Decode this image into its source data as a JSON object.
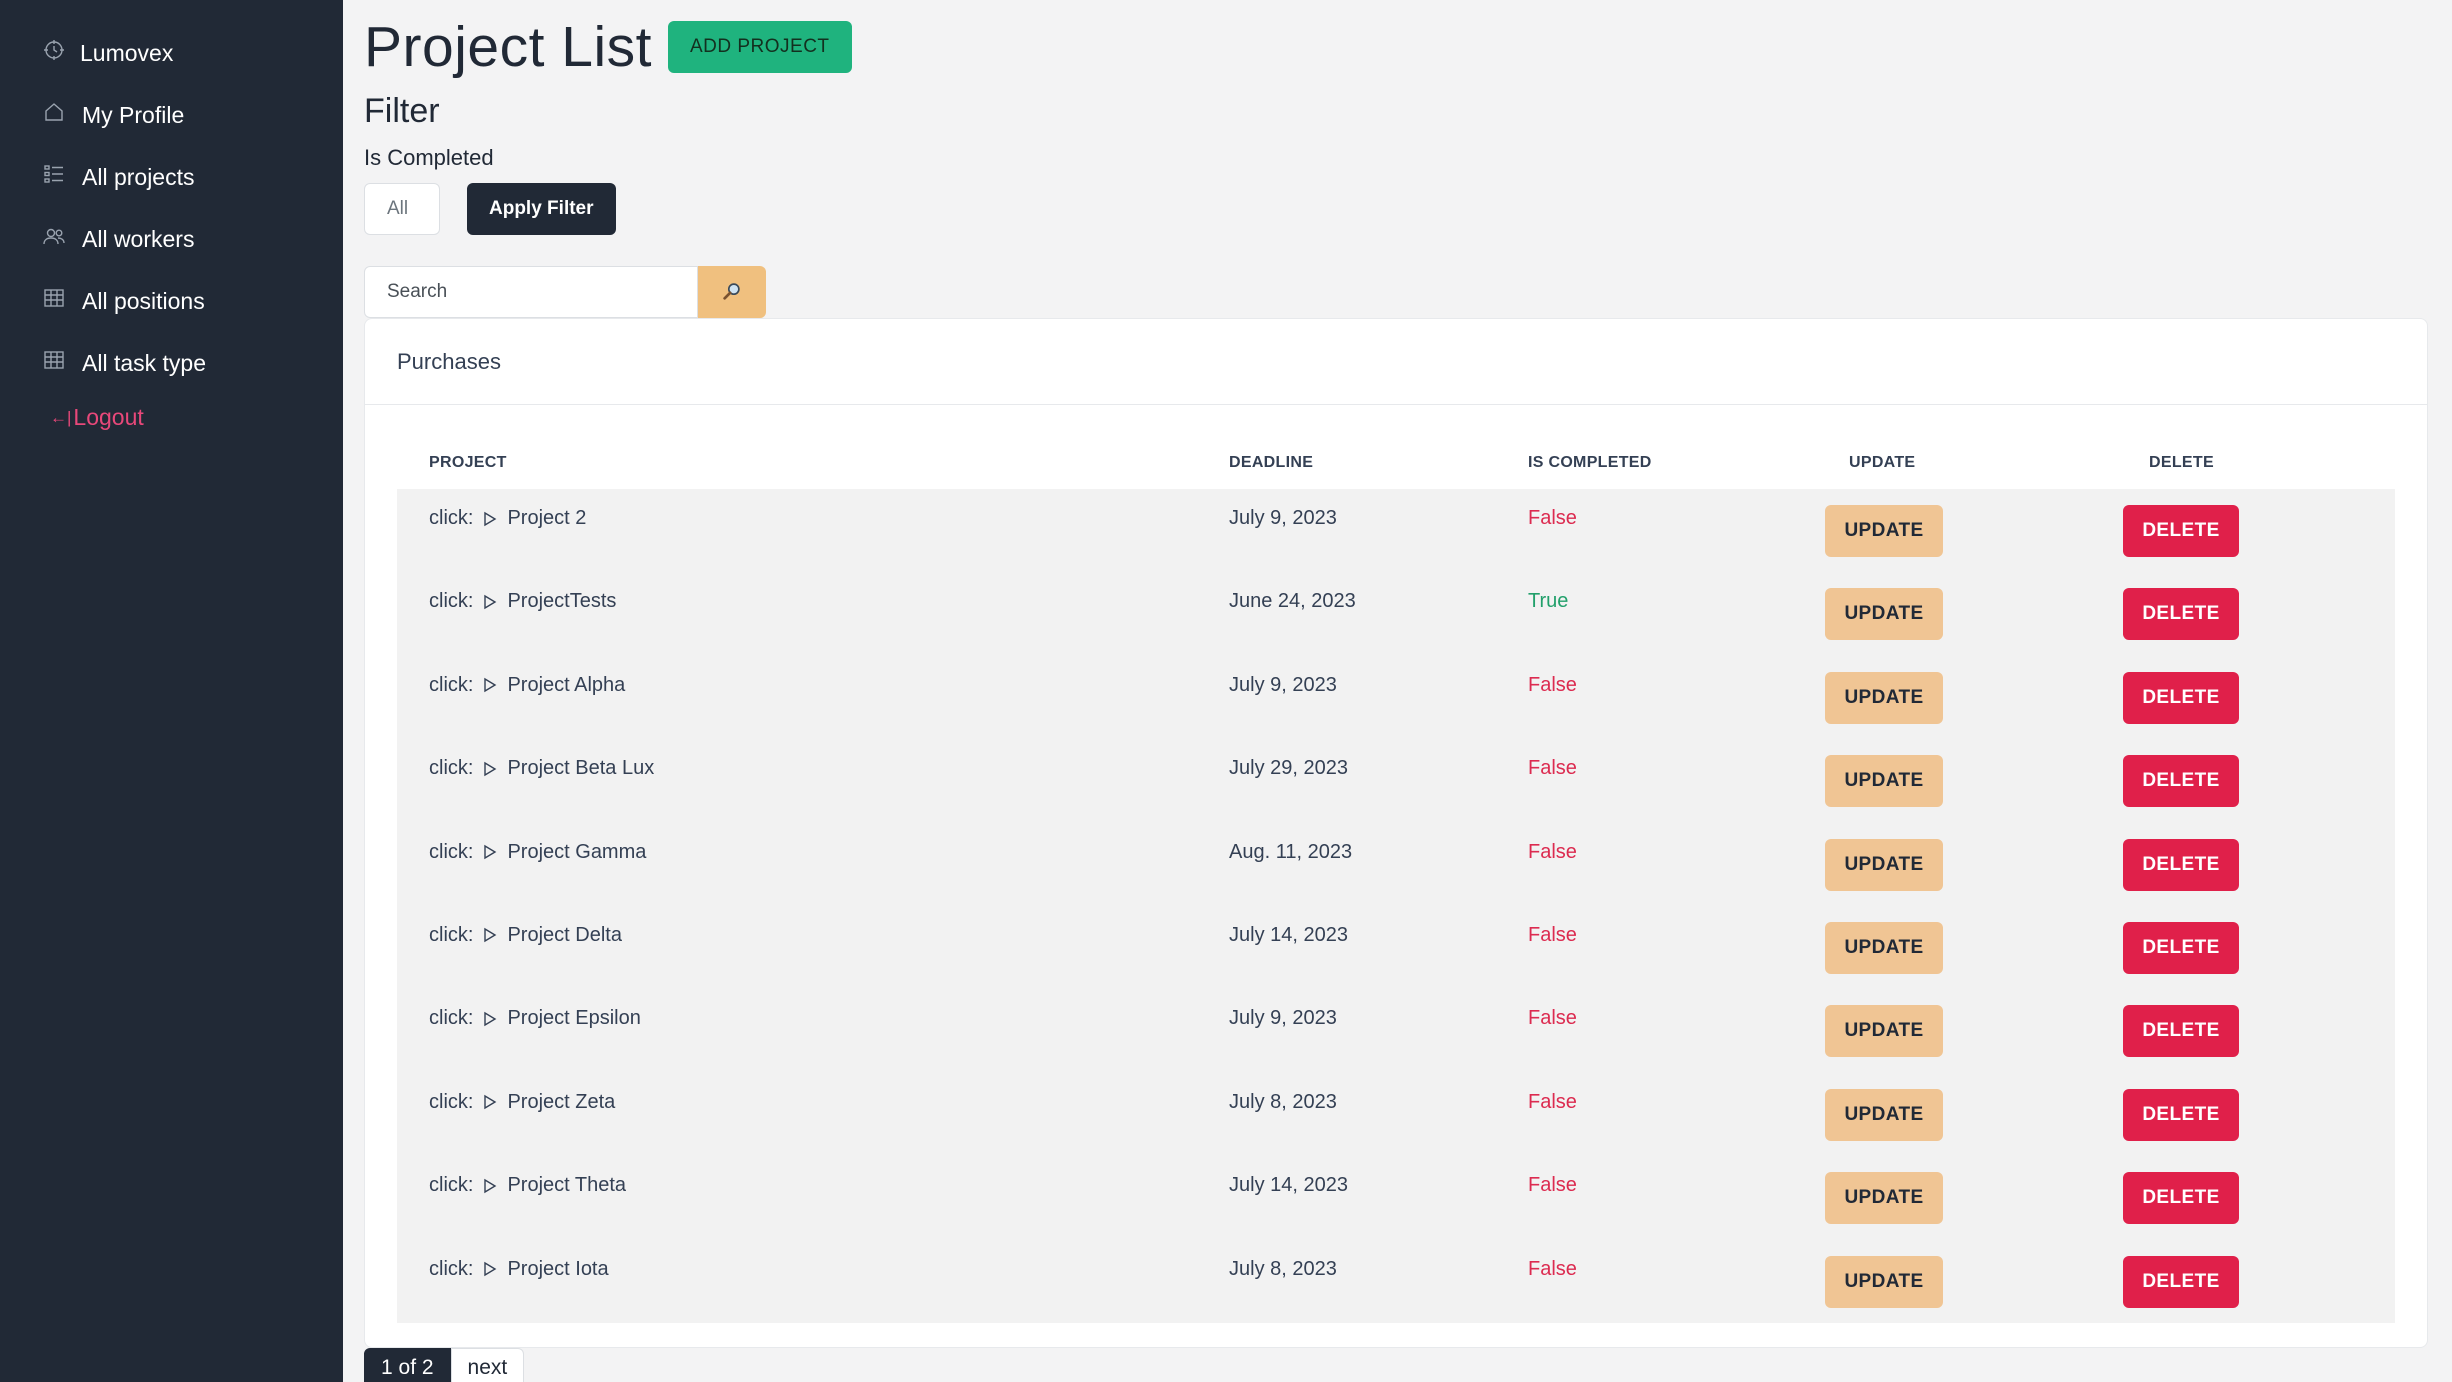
{
  "sidebar": {
    "brand": "Lumovex",
    "items": [
      {
        "label": "My Profile",
        "icon": "home-icon"
      },
      {
        "label": "All projects",
        "icon": "list-icon"
      },
      {
        "label": "All workers",
        "icon": "users-icon"
      },
      {
        "label": "All positions",
        "icon": "table-icon"
      },
      {
        "label": "All task type",
        "icon": "table-icon"
      }
    ],
    "logout_arrow": "←|",
    "logout": "Logout"
  },
  "header": {
    "title": "Project List",
    "add_button": "ADD PROJECT"
  },
  "filter": {
    "title": "Filter",
    "label": "Is Completed",
    "selected": "All",
    "apply_button": "Apply Filter"
  },
  "search": {
    "placeholder": "Search"
  },
  "card": {
    "title": "Purchases"
  },
  "table": {
    "headers": [
      "PROJECT",
      "DEADLINE",
      "IS COMPLETED",
      "UPDATE",
      "DELETE"
    ],
    "click_prefix": "click:",
    "update_label": "UPDATE",
    "delete_label": "DELETE",
    "rows": [
      {
        "name": "Project 2",
        "deadline": "July 9, 2023",
        "completed": "False"
      },
      {
        "name": "ProjectTests",
        "deadline": "June 24, 2023",
        "completed": "True"
      },
      {
        "name": "Project Alpha",
        "deadline": "July 9, 2023",
        "completed": "False"
      },
      {
        "name": "Project Beta Lux",
        "deadline": "July 29, 2023",
        "completed": "False"
      },
      {
        "name": "Project Gamma",
        "deadline": "Aug. 11, 2023",
        "completed": "False"
      },
      {
        "name": "Project Delta",
        "deadline": "July 14, 2023",
        "completed": "False"
      },
      {
        "name": "Project Epsilon",
        "deadline": "July 9, 2023",
        "completed": "False"
      },
      {
        "name": "Project Zeta",
        "deadline": "July 8, 2023",
        "completed": "False"
      },
      {
        "name": "Project Theta",
        "deadline": "July 14, 2023",
        "completed": "False"
      },
      {
        "name": "Project Iota",
        "deadline": "July 8, 2023",
        "completed": "False"
      }
    ]
  },
  "pagination": {
    "current": "1 of 2",
    "next": "next"
  },
  "colors": {
    "sidebar_bg": "#212936",
    "add_button": "#1fb37e",
    "update_button": "#f0c594",
    "delete_button": "#e0204a",
    "false_text": "#dc2b50",
    "true_text": "#22a06b",
    "logout": "#e8487a"
  }
}
